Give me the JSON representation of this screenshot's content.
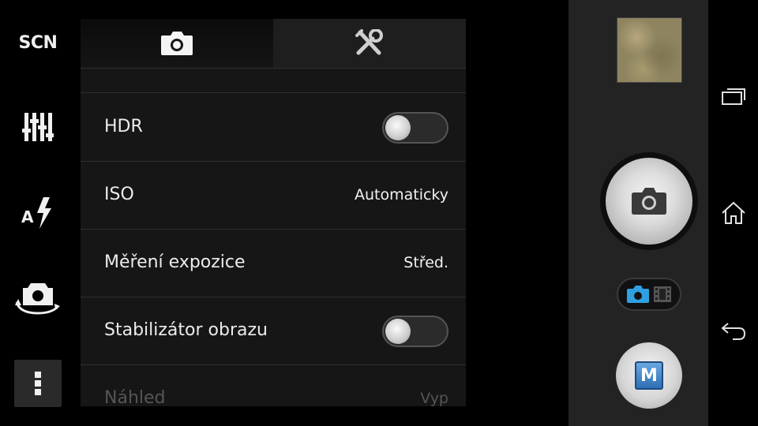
{
  "left_bar": {
    "scene_label": "SCN",
    "icons": [
      "scene-mode",
      "sliders-icon",
      "auto-flash-icon",
      "switch-camera-icon",
      "more-icon"
    ]
  },
  "tabs": [
    {
      "icon": "camera-icon",
      "active": true
    },
    {
      "icon": "tools-icon",
      "active": false
    }
  ],
  "settings": {
    "hdr": {
      "label": "HDR",
      "on": false
    },
    "iso": {
      "label": "ISO",
      "value": "Automaticky"
    },
    "metering": {
      "label": "Měření expozice",
      "value": "Střed."
    },
    "stabilizer": {
      "label": "Stabilizátor obrazu",
      "on": false
    },
    "preview": {
      "label": "Náhled",
      "value": "Vyp"
    }
  },
  "controls": {
    "manual_label": "M",
    "mode": "photo"
  },
  "colors": {
    "accent": "#2fa0e0",
    "panel_bg": "#161616",
    "controls_bg": "#232323"
  }
}
